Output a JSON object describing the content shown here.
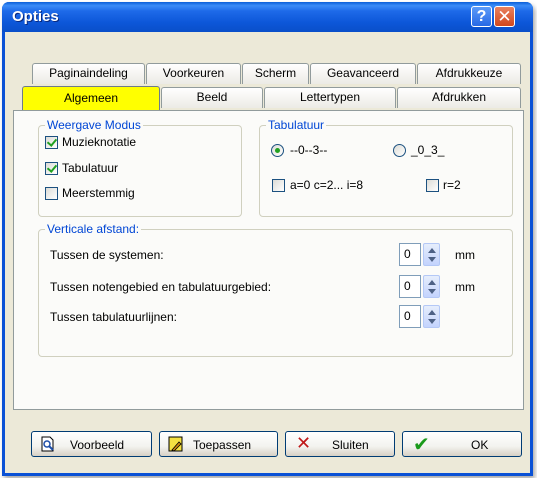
{
  "window": {
    "title": "Opties"
  },
  "tabs": {
    "row1": [
      "Paginaindeling",
      "Voorkeuren",
      "Scherm",
      "Geavanceerd",
      "Afdrukkeuze"
    ],
    "row2": [
      "Algemeen",
      "Beeld",
      "Lettertypen",
      "Afdrukken"
    ],
    "active": "Algemeen"
  },
  "weergave": {
    "title": "Weergave Modus",
    "options": [
      {
        "label": "Muzieknotatie",
        "checked": true
      },
      {
        "label": "Tabulatuur",
        "checked": true
      },
      {
        "label": "Meerstemmig",
        "checked": false
      }
    ]
  },
  "tabulatuur": {
    "title": "Tabulatuur",
    "radio1": {
      "label": "--0--3--",
      "selected": true
    },
    "radio2": {
      "label": "_0_3_",
      "selected": false
    },
    "check1": {
      "label": "a=0 c=2... i=8",
      "checked": false
    },
    "check2": {
      "label": "r=2",
      "checked": false
    }
  },
  "verticaal": {
    "title": "Verticale afstand:",
    "rows": [
      {
        "label": "Tussen de systemen:",
        "value": "0",
        "unit": "mm"
      },
      {
        "label": "Tussen notengebied en tabulatuurgebied:",
        "value": "0",
        "unit": "mm"
      },
      {
        "label": "Tussen tabulatuurlijnen:",
        "value": "0",
        "unit": ""
      }
    ]
  },
  "buttons": {
    "voorbeeld": "Voorbeeld",
    "toepassen": "Toepassen",
    "sluiten": "Sluiten",
    "ok": "OK"
  },
  "colors": {
    "titlebar": "#0a5ed8",
    "activeTab": "#ffff00",
    "groupTitle": "#0046d5"
  }
}
